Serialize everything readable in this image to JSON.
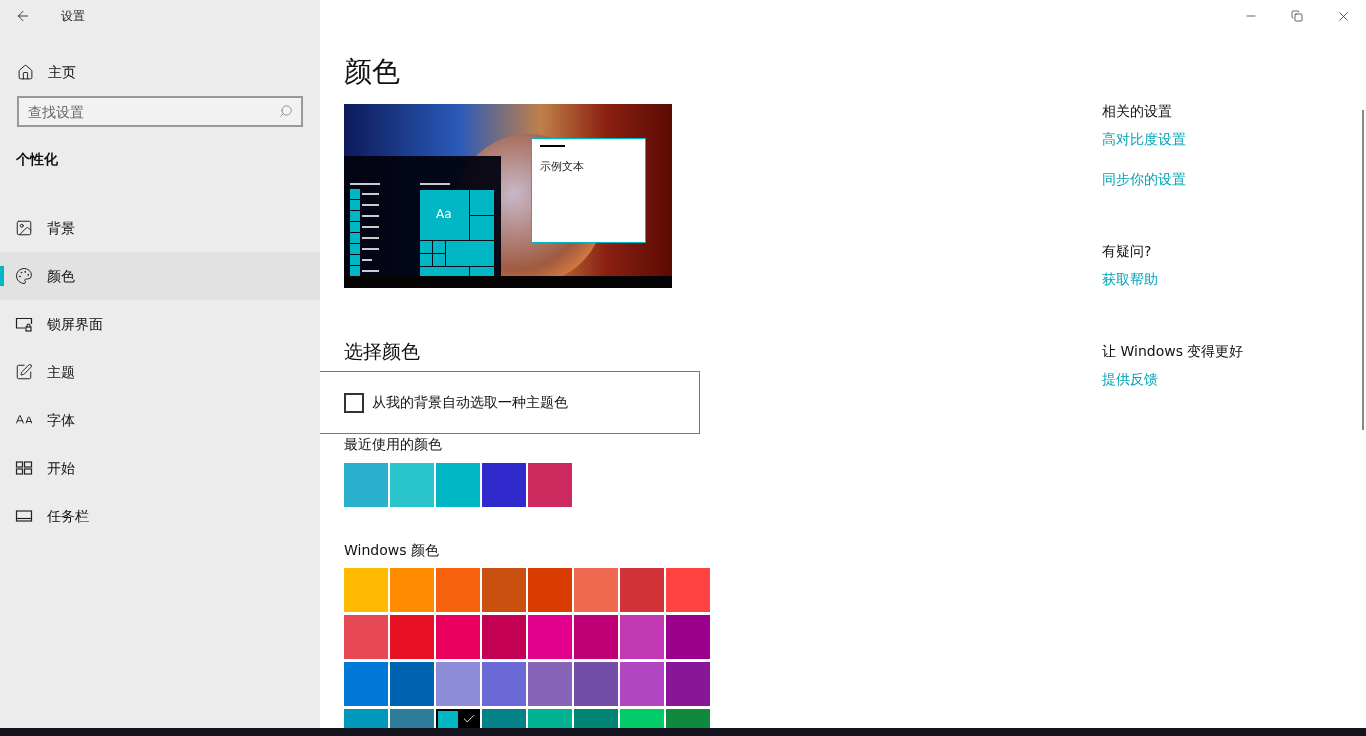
{
  "window": {
    "title": "设置"
  },
  "sidebar": {
    "home": "主页",
    "search": {
      "placeholder": "查找设置"
    },
    "section": "个性化",
    "items": [
      {
        "label": "背景",
        "selected": false
      },
      {
        "label": "颜色",
        "selected": true
      },
      {
        "label": "锁屏界面",
        "selected": false
      },
      {
        "label": "主题",
        "selected": false
      },
      {
        "label": "字体",
        "selected": false
      },
      {
        "label": "开始",
        "selected": false
      },
      {
        "label": "任务栏",
        "selected": false
      }
    ]
  },
  "page": {
    "title": "颜色",
    "preview": {
      "tile_text": "Aa",
      "sample_text": "示例文本"
    },
    "choose_heading": "选择颜色",
    "auto_pick": {
      "label": "从我的背景自动选取一种主题色",
      "checked": false
    },
    "recent": {
      "heading": "最近使用的颜色",
      "swatches": [
        {
          "color": "#2ab0cc",
          "selected": false
        },
        {
          "color": "#2ac4cc",
          "selected": false
        },
        {
          "color": "#00b7c3",
          "selected": false
        },
        {
          "color": "#3029cc",
          "selected": false
        },
        {
          "color": "#cc2a5e",
          "selected": false
        }
      ]
    },
    "windows_colors": {
      "heading": "Windows 颜色",
      "swatches": [
        {
          "color": "#ffb900",
          "selected": false
        },
        {
          "color": "#ff8c00",
          "selected": false
        },
        {
          "color": "#f7630c",
          "selected": false
        },
        {
          "color": "#ca5010",
          "selected": false
        },
        {
          "color": "#da3b01",
          "selected": false
        },
        {
          "color": "#ef6950",
          "selected": false
        },
        {
          "color": "#d13438",
          "selected": false
        },
        {
          "color": "#ff4343",
          "selected": false
        },
        {
          "color": "#e74856",
          "selected": false
        },
        {
          "color": "#e81123",
          "selected": false
        },
        {
          "color": "#ea005e",
          "selected": false
        },
        {
          "color": "#c30052",
          "selected": false
        },
        {
          "color": "#e3008c",
          "selected": false
        },
        {
          "color": "#bf0077",
          "selected": false
        },
        {
          "color": "#c239b3",
          "selected": false
        },
        {
          "color": "#9a0089",
          "selected": false
        },
        {
          "color": "#0078d7",
          "selected": false
        },
        {
          "color": "#0063b1",
          "selected": false
        },
        {
          "color": "#8e8cd8",
          "selected": false
        },
        {
          "color": "#6b69d6",
          "selected": false
        },
        {
          "color": "#8764b8",
          "selected": false
        },
        {
          "color": "#744da9",
          "selected": false
        },
        {
          "color": "#b146c2",
          "selected": false
        },
        {
          "color": "#881798",
          "selected": false
        },
        {
          "color": "#0099bc",
          "selected": false
        },
        {
          "color": "#2d7d9a",
          "selected": false
        },
        {
          "color": "#00b7c3",
          "selected": true
        },
        {
          "color": "#038387",
          "selected": false
        },
        {
          "color": "#00b294",
          "selected": false
        },
        {
          "color": "#018574",
          "selected": false
        },
        {
          "color": "#00cc6a",
          "selected": false
        },
        {
          "color": "#10893e",
          "selected": false
        }
      ]
    }
  },
  "aside": [
    {
      "heading": "相关的设置",
      "links": [
        "高对比度设置",
        "同步你的设置"
      ]
    },
    {
      "heading": "有疑问?",
      "links": [
        "获取帮助"
      ]
    },
    {
      "heading": "让 Windows 变得更好",
      "links": [
        "提供反馈"
      ]
    }
  ]
}
